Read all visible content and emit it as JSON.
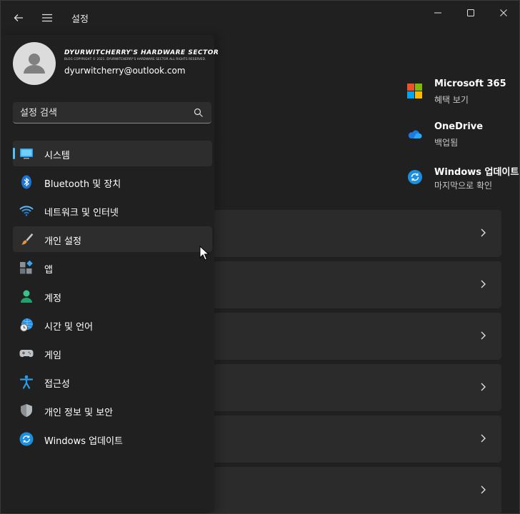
{
  "window": {
    "title": "설정"
  },
  "account": {
    "name": "DYURWITCHERRY'S HARDWARE SECTOR",
    "subtitle": "BLOG COPYRIGHT © 2021. DYURWITCHERRY'S HARDWARE SECTOR ALL RIGHTS RESERVED.",
    "email": "dyurwitcherry@outlook.com"
  },
  "search": {
    "placeholder": "설정 검색"
  },
  "nav": {
    "items": [
      {
        "label": "시스템",
        "icon": "system-icon"
      },
      {
        "label": "Bluetooth 및 장치",
        "icon": "bluetooth-icon"
      },
      {
        "label": "네트워크 및 인터넷",
        "icon": "wifi-icon"
      },
      {
        "label": "개인 설정",
        "icon": "brush-icon"
      },
      {
        "label": "앱",
        "icon": "apps-icon"
      },
      {
        "label": "계정",
        "icon": "person-icon"
      },
      {
        "label": "시간 및 언어",
        "icon": "globe-clock-icon"
      },
      {
        "label": "게임",
        "icon": "gamepad-icon"
      },
      {
        "label": "접근성",
        "icon": "accessibility-icon"
      },
      {
        "label": "개인 정보 및 보안",
        "icon": "shield-icon"
      },
      {
        "label": "Windows 업데이트",
        "icon": "update-icon"
      }
    ]
  },
  "right": {
    "items": [
      {
        "title": "Microsoft 365",
        "sub": "혜택 보기",
        "icon": "microsoft-logo-icon"
      },
      {
        "title": "OneDrive",
        "sub": "백업됨",
        "icon": "cloud-icon"
      },
      {
        "title": "Windows 업데이트",
        "sub": "마지막으로 확인",
        "icon": "update-icon"
      }
    ]
  },
  "colors": {
    "accent": "#4cc2ff",
    "background": "#202020",
    "card": "#2b2b2b"
  }
}
